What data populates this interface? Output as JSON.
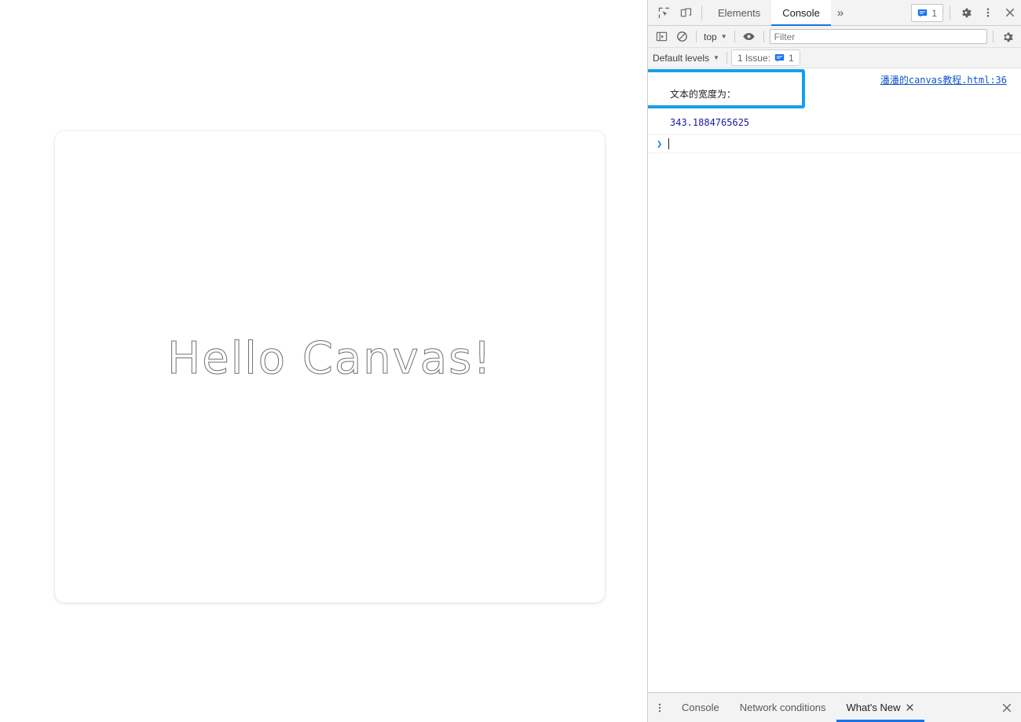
{
  "page": {
    "canvas": {
      "text": "Hello Canvas!",
      "render_mode": "stroke-text",
      "stroke_color": "#6e7176"
    }
  },
  "devtools": {
    "tabbar": {
      "inspect_icon": "inspect-element-icon",
      "device_icon": "device-toolbar-icon",
      "tabs": [
        {
          "label": "Elements",
          "active": false
        },
        {
          "label": "Console",
          "active": true
        }
      ],
      "more_tabs_label": "»",
      "issues_count": "1",
      "settings_icon": "gear-icon",
      "menu_icon": "kebab-menu-icon",
      "close_icon": "close-icon"
    },
    "consolebar": {
      "sidebar_icon": "console-sidebar-icon",
      "clear_icon": "clear-console-icon",
      "context_value": "top",
      "eye_icon": "live-expression-eye-icon",
      "filter_placeholder": "Filter",
      "filter_value": "",
      "settings_icon": "console-settings-gear-icon"
    },
    "levelsbar": {
      "levels_label": "Default levels",
      "issue_label": "1 Issue:",
      "issue_count": "1"
    },
    "console": {
      "message_line1": "文本的宽度为：",
      "message_line2": "343.1884765625",
      "source_link": "潘潘的canvas教程.html:36",
      "prompt_symbol": "❯"
    },
    "drawer": {
      "menu_icon": "drawer-kebab-icon",
      "tabs": [
        {
          "label": "Console",
          "active": false,
          "closable": false
        },
        {
          "label": "Network conditions",
          "active": false,
          "closable": false
        },
        {
          "label": "What's New",
          "active": true,
          "closable": true
        }
      ],
      "close_icon": "drawer-close-icon"
    }
  },
  "colors": {
    "accent_blue": "#1a73e8",
    "annotation_blue": "#15a0e8",
    "link_blue": "#1155cc",
    "number_blue": "#1a1aa6",
    "toolbar_bg": "#f3f3f3"
  }
}
